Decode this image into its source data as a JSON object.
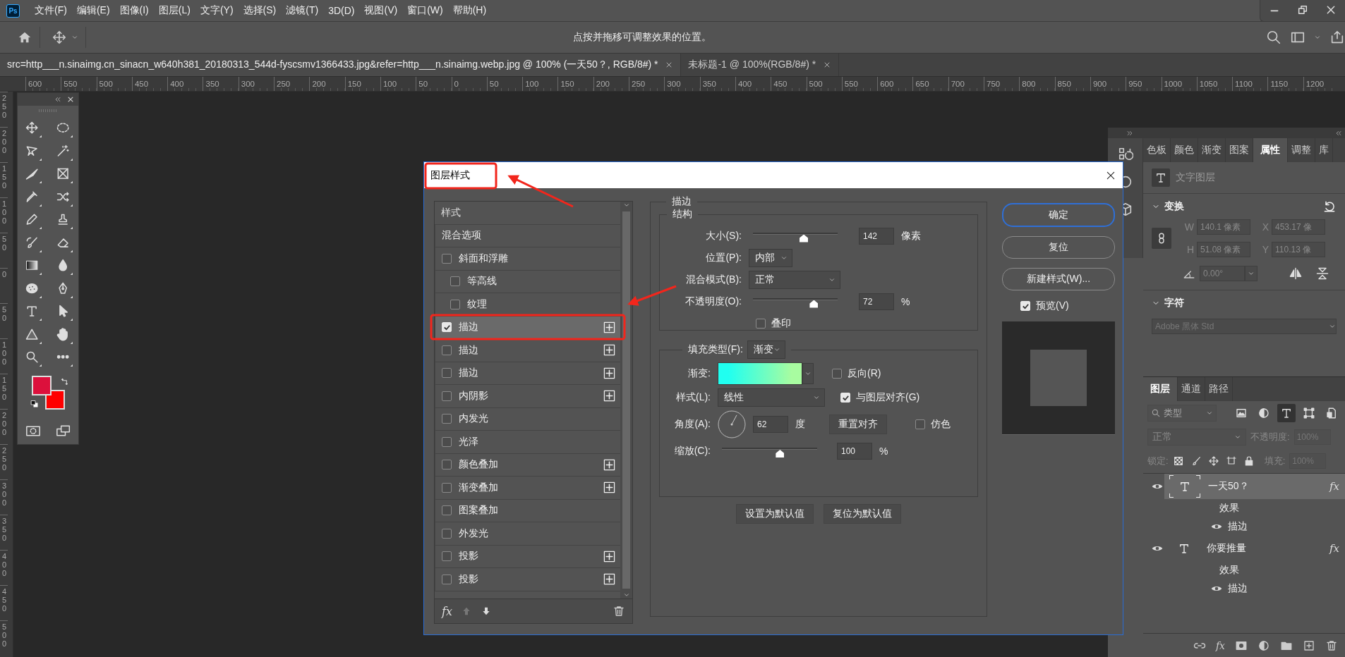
{
  "app": {
    "logo": "Ps"
  },
  "menu": [
    "文件(F)",
    "编辑(E)",
    "图像(I)",
    "图层(L)",
    "文字(Y)",
    "选择(S)",
    "滤镜(T)",
    "3D(D)",
    "视图(V)",
    "窗口(W)",
    "帮助(H)"
  ],
  "options_bar": {
    "hint": "点按并拖移可调整效果的位置。"
  },
  "document_tabs": [
    {
      "title": "src=http___n.sinaimg.cn_sinacn_w640h381_20180313_544d-fyscsmv1366433.jpg&refer=http___n.sinaimg.webp.jpg @ 100% (一天50？, RGB/8#) *",
      "selected": true
    },
    {
      "title": "未标题-1 @ 100%(RGB/8#) *",
      "selected": false
    }
  ],
  "rulers": {
    "horizontal": [
      "600",
      "550",
      "500",
      "450",
      "400",
      "350",
      "300",
      "250",
      "200",
      "150",
      "100",
      "50",
      "0",
      "50",
      "100",
      "150",
      "200",
      "250",
      "300",
      "350",
      "400",
      "450",
      "500",
      "550",
      "600",
      "650",
      "700",
      "750",
      "800",
      "850",
      "900",
      "950",
      "1000",
      "1050",
      "1100",
      "1150",
      "1200"
    ],
    "vertical": [
      "250",
      "200",
      "150",
      "100",
      "50",
      "0",
      "50",
      "100",
      "150",
      "200",
      "250",
      "300",
      "350",
      "400",
      "450",
      "500"
    ]
  },
  "toolbar": {
    "swatches": [
      {
        "kind": "foreground",
        "color": "#dc103c"
      },
      {
        "kind": "background",
        "color": "#ff0000"
      }
    ]
  },
  "dialog": {
    "title": "图层样式",
    "style_list": {
      "heading": "样式",
      "items": [
        {
          "label": "混合选项",
          "kind": "option",
          "selected": false
        },
        {
          "label": "斜面和浮雕",
          "kind": "effect",
          "checked": false,
          "selected": false,
          "addable": false,
          "children": [
            {
              "label": "等高线",
              "kind": "effect",
              "checked": false,
              "selected": false,
              "addable": false
            },
            {
              "label": "纹理",
              "kind": "effect",
              "checked": false,
              "selected": false,
              "addable": false
            }
          ]
        },
        {
          "label": "描边",
          "kind": "effect",
          "checked": true,
          "selected": true,
          "addable": true
        },
        {
          "label": "描边",
          "kind": "effect",
          "checked": false,
          "selected": false,
          "addable": true
        },
        {
          "label": "描边",
          "kind": "effect",
          "checked": false,
          "selected": false,
          "addable": true
        },
        {
          "label": "内阴影",
          "kind": "effect",
          "checked": false,
          "selected": false,
          "addable": true
        },
        {
          "label": "内发光",
          "kind": "effect",
          "checked": false,
          "selected": false,
          "addable": false
        },
        {
          "label": "光泽",
          "kind": "effect",
          "checked": false,
          "selected": false,
          "addable": false
        },
        {
          "label": "颜色叠加",
          "kind": "effect",
          "checked": false,
          "selected": false,
          "addable": true
        },
        {
          "label": "渐变叠加",
          "kind": "effect",
          "checked": false,
          "selected": false,
          "addable": true
        },
        {
          "label": "图案叠加",
          "kind": "effect",
          "checked": false,
          "selected": false,
          "addable": false
        },
        {
          "label": "外发光",
          "kind": "effect",
          "checked": false,
          "selected": false,
          "addable": false
        },
        {
          "label": "投影",
          "kind": "effect",
          "checked": false,
          "selected": false,
          "addable": true
        },
        {
          "label": "投影",
          "kind": "effect",
          "checked": false,
          "selected": false,
          "addable": true
        }
      ],
      "footer_fx": "fx"
    },
    "stroke": {
      "title": "描边",
      "structure": {
        "title": "结构",
        "size": {
          "label": "大小(S):",
          "level": 0.6,
          "value": "142",
          "unit": "像素"
        },
        "position": {
          "label": "位置(P):",
          "value": "内部"
        },
        "blend_mode": {
          "label": "混合模式(B):",
          "value": "正常"
        },
        "opacity": {
          "label": "不透明度(O):",
          "level": 0.72,
          "value": "72",
          "unit": "%"
        },
        "overprint": {
          "label": "叠印",
          "checked": false
        }
      },
      "fill": {
        "label": "填充类型(F):",
        "value": "渐变",
        "gradient": {
          "label": "渐变:",
          "stops": [
            {
              "color": "#20fff0"
            },
            {
              "color": "#a8fca0"
            }
          ]
        },
        "reverse": {
          "label": "反向(R)",
          "checked": false
        },
        "style": {
          "label": "样式(L):",
          "value": "线性"
        },
        "align": {
          "label": "与图层对齐(G)",
          "checked": true
        },
        "angle": {
          "label": "角度(A):",
          "value": "62",
          "unit": "度"
        },
        "reset_align": "重置对齐",
        "dither": {
          "label": "仿色",
          "checked": false
        },
        "scale": {
          "label": "缩放(C):",
          "level": 0.61,
          "value": "100",
          "unit": "%"
        }
      },
      "default_buttons": [
        "设置为默认值",
        "复位为默认值"
      ]
    },
    "buttons": [
      {
        "label": "确定",
        "kind": "default"
      },
      {
        "label": "复位",
        "kind": "normal"
      },
      {
        "label": "新建样式(W)...",
        "kind": "normal"
      }
    ],
    "preview": {
      "label": "预览(V)",
      "checked": true
    }
  },
  "properties_panel": {
    "tabs": [
      {
        "label": "色板",
        "selected": false
      },
      {
        "label": "颜色",
        "selected": false
      },
      {
        "label": "渐变",
        "selected": false
      },
      {
        "label": "图案",
        "selected": false
      },
      {
        "label": "属性",
        "selected": true
      },
      {
        "label": "调整",
        "selected": false
      },
      {
        "label": "库",
        "selected": false
      }
    ],
    "layer_type": "文字图层",
    "transform": {
      "title": "变换",
      "fields": [
        {
          "label": "W",
          "value": "140.1 像素",
          "disabled": true
        },
        {
          "label": "X",
          "value": "453.17 像",
          "disabled": true
        },
        {
          "label": "H",
          "value": "51.08 像素",
          "disabled": true
        },
        {
          "label": "Y",
          "value": "110.13 像",
          "disabled": true
        }
      ],
      "angle": "0.00°"
    },
    "character": {
      "title": "字符",
      "font": "Adobe 黑体 Std"
    }
  },
  "layers_panel": {
    "tabs": [
      {
        "label": "图层",
        "selected": true
      },
      {
        "label": "通道",
        "selected": false
      },
      {
        "label": "路径",
        "selected": false
      }
    ],
    "filter": "类型",
    "filter_buttons": [
      {
        "kind": "image",
        "selected": false
      },
      {
        "kind": "adjustment",
        "selected": false
      },
      {
        "kind": "type",
        "selected": true
      },
      {
        "kind": "shape",
        "selected": false
      },
      {
        "kind": "smart",
        "selected": false
      }
    ],
    "blend_mode": "正常",
    "opacity_label": "不透明度:",
    "opacity": "100%",
    "lock_label": "锁定:",
    "fill_label": "填充:",
    "fill": "100%",
    "layers": [
      {
        "name": "一天50？",
        "selected": true,
        "visible": true,
        "fx": "fx",
        "effects_label": "效果",
        "effects": [
          {
            "name": "描边",
            "visible": true
          }
        ]
      },
      {
        "name": "你要推量",
        "selected": false,
        "visible": true,
        "fx": "fx",
        "effects_label": "效果",
        "effects": [
          {
            "name": "描边",
            "visible": true
          }
        ]
      }
    ],
    "bottom_fx": "fx"
  }
}
